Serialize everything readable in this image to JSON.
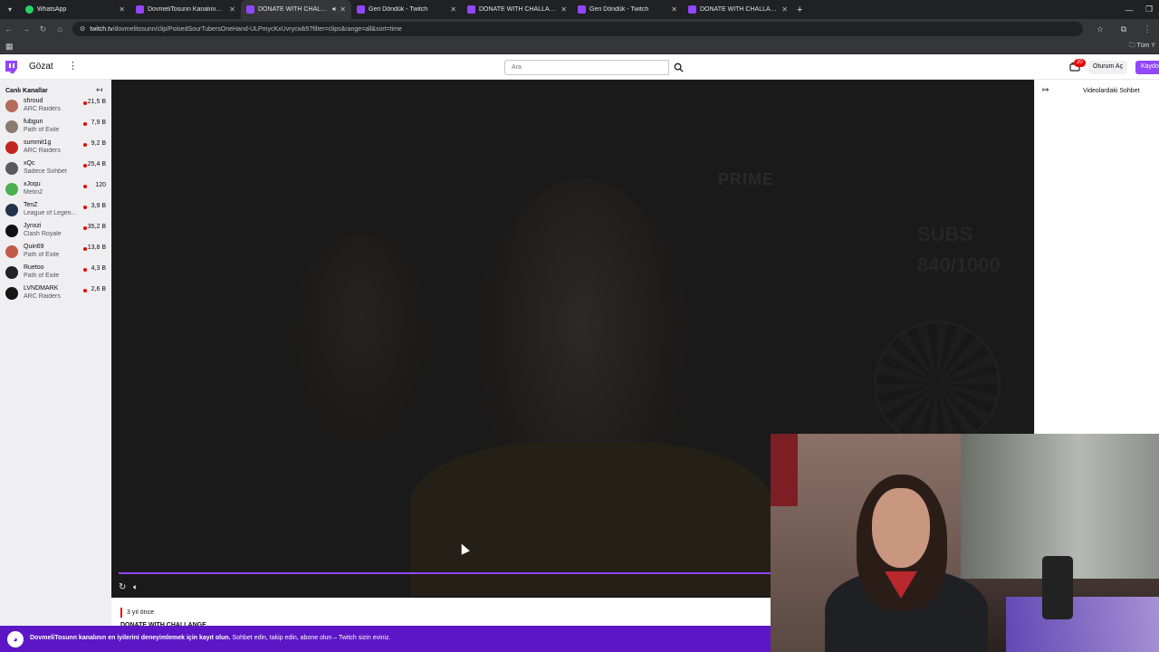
{
  "browser": {
    "tabs": [
      {
        "title": "WhatsApp",
        "type": "wa",
        "active": false
      },
      {
        "title": "DovmeliTosunn Kanalının Video",
        "type": "tw",
        "active": false
      },
      {
        "title": "DONATE WITH CHALLANGE",
        "type": "tw",
        "active": true
      },
      {
        "title": "Geri Döndük - Twitch",
        "type": "tw",
        "active": false
      },
      {
        "title": "DONATE WITH CHALLANGE - T",
        "type": "tw",
        "active": false
      },
      {
        "title": "Geri Döndük - Twitch",
        "type": "tw",
        "active": false
      },
      {
        "title": "DONATE WITH CHALLANGE - T",
        "type": "tw",
        "active": false
      }
    ],
    "url_host": "twitch.tv",
    "url_path": "/dovmelitosunn/clip/PoisedSourTubersOneHand-ULPmycKxUvrycwb5?filter=clips&range=all&sort=time",
    "all_bookmarks": "Tüm Y"
  },
  "twitch": {
    "browse": "Gözat",
    "search_placeholder": "Ara",
    "notif_count": "20",
    "login": "Oturum Aç",
    "signup": "Kaydol",
    "accent": "#9146ff"
  },
  "sidebar": {
    "heading": "Canlı Kanallar",
    "channels": [
      {
        "name": "shroud",
        "game": "ARC Raiders",
        "viewers": "21,5 B",
        "color": "#b36b5a"
      },
      {
        "name": "fubgun",
        "game": "Path of Exile",
        "viewers": "7,9 B",
        "color": "#8a7a70"
      },
      {
        "name": "summit1g",
        "game": "ARC Raiders",
        "viewers": "9,2 B",
        "color": "#c0261f"
      },
      {
        "name": "xQc",
        "game": "Sadece Sohbet",
        "viewers": "25,4 B",
        "color": "#5a5a5a"
      },
      {
        "name": "xJoqu",
        "game": "Metin2",
        "viewers": "120",
        "color": "#4caf50"
      },
      {
        "name": "TenZ",
        "game": "League of Legen...",
        "viewers": "3,9 B",
        "color": "#22324a"
      },
      {
        "name": "Jynxzi",
        "game": "Clash Royale",
        "viewers": "35,2 B",
        "color": "#111111"
      },
      {
        "name": "Quin69",
        "game": "Path of Exile",
        "viewers": "13,8 B",
        "color": "#c45a4a"
      },
      {
        "name": "Ruetoo",
        "game": "Path of Exile",
        "viewers": "4,3 B",
        "color": "#222222"
      },
      {
        "name": "LVNDMARK",
        "game": "ARC Raiders",
        "viewers": "2,6 B",
        "color": "#151515"
      }
    ]
  },
  "video": {
    "wm_prime": "PRIME",
    "wm_subs": "SUBS",
    "wm_count": "840/1000"
  },
  "chat": {
    "title": "Videolardaki Sohbet"
  },
  "clip": {
    "age": "3 yıl önce",
    "title": "DONATE WITH CHALLANGE"
  },
  "banner": {
    "bold": "DovmeliTosunn kanalının en iyilerini deneyimlemek için kayıt olun.",
    "rest": " Sohbet edin, takip edin, abone olun – Twitch sizin eviniz."
  }
}
